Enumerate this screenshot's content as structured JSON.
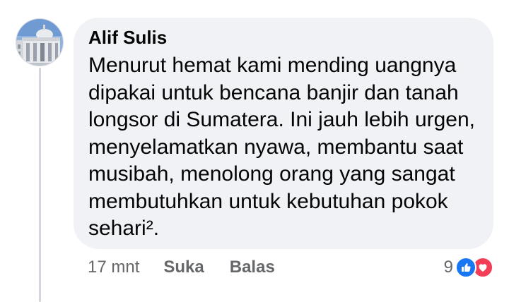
{
  "comment": {
    "author": "Alif Sulis",
    "text": "Menurut hemat kami mending uangnya\ndipakai untuk bencana banjir dan tanah\nlongsor di Sumatera. Ini jauh lebih urgen,\nmenyelamatkan nyawa, membantu saat\nmusibah, menolong orang yang sangat\nmembutuhkan untuk kebutuhan pokok\nsehari².",
    "timestamp": "17 mnt",
    "actions": {
      "like_label": "Suka",
      "reply_label": "Balas"
    },
    "reactions": {
      "count": "9",
      "types": [
        "like-icon",
        "love-icon"
      ]
    }
  },
  "colors": {
    "bubble_bg": "#f0f2f5",
    "meta_text": "#65676b",
    "like_blue": "#1877f2",
    "love_red": "#f33e58",
    "thread_line": "#d3d6db"
  }
}
